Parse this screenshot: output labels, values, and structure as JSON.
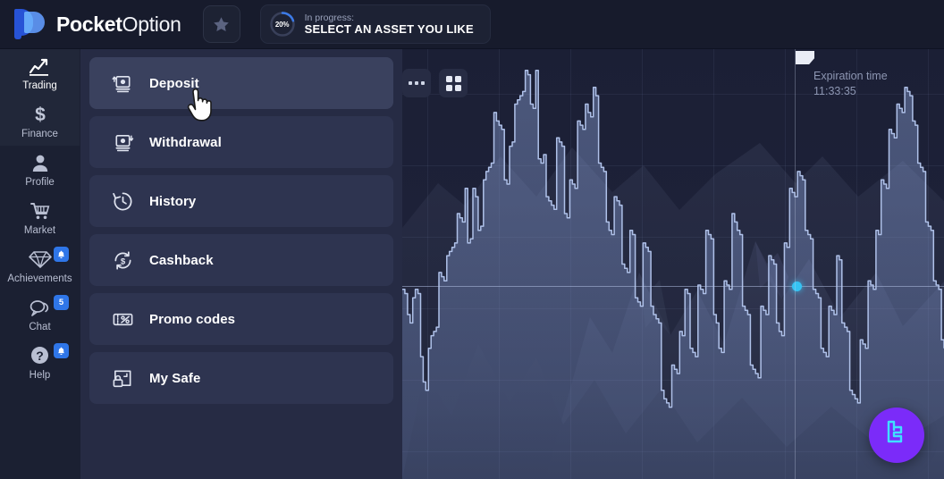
{
  "brand": {
    "name_bold": "Pocket",
    "name_light": "Option",
    "logo_dark_color": "#2753D6",
    "logo_light_color": "#4F8BF5"
  },
  "topbar": {
    "favorites_icon": "star-icon",
    "progress": {
      "percent_label": "20%",
      "percent_value": 20,
      "status_label": "In progress:",
      "task_label": "SELECT AN ASSET YOU LIKE",
      "ring_color": "#3C7BE8",
      "ring_track_color": "#39405a"
    }
  },
  "sidebar": {
    "items": [
      {
        "label": "Trading",
        "icon": "chart-line-icon",
        "active": true,
        "badge": null
      },
      {
        "label": "Finance",
        "icon": "dollar-icon",
        "active": false,
        "badge": null
      },
      {
        "label": "Profile",
        "icon": "user-icon",
        "active": false,
        "badge": null
      },
      {
        "label": "Market",
        "icon": "cart-icon",
        "active": false,
        "badge": null
      },
      {
        "label": "Achievements",
        "icon": "diamond-icon",
        "active": false,
        "badge": "bell"
      },
      {
        "label": "Chat",
        "icon": "chat-icon",
        "active": false,
        "badge": "5"
      },
      {
        "label": "Help",
        "icon": "question-icon",
        "active": false,
        "badge": "bell"
      }
    ],
    "badge_color": "#2F76E8"
  },
  "menu": {
    "items": [
      {
        "label": "Deposit",
        "icon": "deposit-icon",
        "hovered": true
      },
      {
        "label": "Withdrawal",
        "icon": "withdrawal-icon",
        "hovered": false
      },
      {
        "label": "History",
        "icon": "history-icon",
        "hovered": false
      },
      {
        "label": "Cashback",
        "icon": "cashback-icon",
        "hovered": false
      },
      {
        "label": "Promo codes",
        "icon": "promo-icon",
        "hovered": false
      },
      {
        "label": "My Safe",
        "icon": "safe-icon",
        "hovered": false
      }
    ],
    "panel_color": "#262B44",
    "item_color": "#2E3450",
    "item_hover_color": "#3A415E"
  },
  "chart": {
    "toolbar": [
      {
        "name": "more-options-button",
        "icon": "ellipsis-icon"
      },
      {
        "name": "layout-grid-button",
        "icon": "grid-four-icon"
      }
    ],
    "expiration": {
      "title": "Expiration time",
      "time": "11:33:35"
    },
    "price_dot_color": "#35C3F3",
    "line_color": "#A9BCE8",
    "fill_color": "#7E95CF"
  },
  "fab": {
    "name": "support-chat-button",
    "icon": "logo-c-icon",
    "background": "#7B2BF9",
    "glyph_color": "#3FE0FF"
  },
  "cursor": {
    "type": "pointing-hand-cursor"
  },
  "chart_data": {
    "type": "area",
    "title": "",
    "xlabel": "",
    "ylabel": "",
    "grid": true,
    "legend": null,
    "ylim": [
      0,
      100
    ],
    "price_line_y": 52,
    "expiration_x_pct": 72.4,
    "values": [
      44,
      43,
      38,
      36,
      42,
      44,
      43,
      28,
      22,
      20,
      30,
      33,
      34,
      35,
      48,
      47,
      46,
      52,
      53,
      54,
      55,
      62,
      61,
      60,
      68,
      55,
      56,
      68,
      66,
      58,
      59,
      70,
      72,
      73,
      74,
      86,
      84,
      83,
      82,
      70,
      69,
      78,
      79,
      88,
      89,
      90,
      91,
      96,
      95,
      88,
      87,
      96,
      75,
      74,
      76,
      66,
      65,
      64,
      63,
      80,
      79,
      78,
      62,
      61,
      70,
      69,
      68,
      84,
      83,
      82,
      88,
      86,
      85,
      92,
      90,
      74,
      73,
      72,
      60,
      58,
      57,
      66,
      65,
      64,
      50,
      49,
      48,
      58,
      57,
      42,
      41,
      40,
      55,
      54,
      53,
      40,
      38,
      37,
      36,
      20,
      18,
      17,
      16,
      26,
      25,
      24,
      34,
      33,
      44,
      43,
      30,
      29,
      28,
      45,
      44,
      43,
      58,
      57,
      56,
      38,
      36,
      30,
      29,
      46,
      45,
      44,
      62,
      60,
      58,
      57,
      40,
      39,
      38,
      26,
      25,
      24,
      23,
      40,
      39,
      38,
      52,
      51,
      50,
      36,
      34,
      33,
      55,
      54,
      68,
      67,
      66,
      72,
      71,
      70,
      58,
      57,
      56,
      44,
      43,
      42,
      30,
      29,
      28,
      40,
      39,
      38,
      52,
      51,
      36,
      35,
      34,
      20,
      19,
      18,
      17,
      32,
      31,
      30,
      46,
      45,
      44,
      58,
      57,
      70,
      69,
      68,
      82,
      81,
      80,
      88,
      87,
      86,
      92,
      91,
      90,
      84,
      83,
      74,
      73,
      72,
      60,
      59,
      58,
      46,
      45,
      44,
      32,
      30
    ]
  }
}
